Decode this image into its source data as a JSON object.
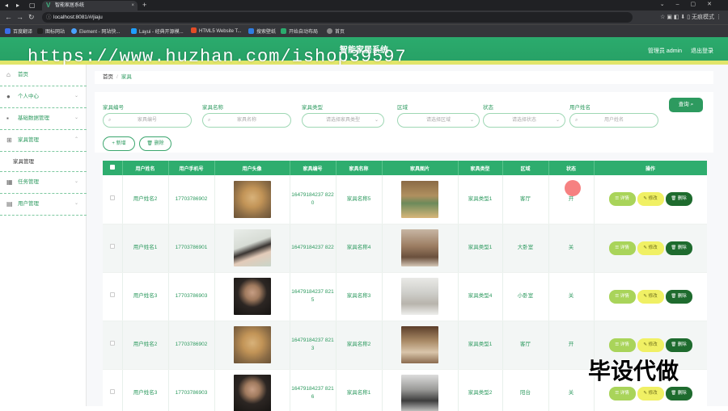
{
  "browser": {
    "tab_title": "智能家居系统",
    "url": "localhost:8081/#/jiaju",
    "profile_label": "无痕模式",
    "bookmarks": [
      "百度翻译",
      "图标网站",
      "Element - 网站快...",
      "Layui - 经典开源模...",
      "HTML5 Website T...",
      "搜索壁纸",
      "开始自动布局",
      "首页"
    ]
  },
  "header": {
    "title": "智能家居系统",
    "user": "管理员 admin",
    "logout": "退出登录"
  },
  "watermark_url": "https://www.huzhan.com/ishop39597",
  "watermark_corner": "毕设代做",
  "sidebar": {
    "items": [
      {
        "label": "首页",
        "icon": "home-icon"
      },
      {
        "label": "个人中心",
        "icon": "user-icon"
      },
      {
        "label": "基础数据管理",
        "icon": "briefcase-icon"
      },
      {
        "label": "家具管理",
        "icon": "grid-icon"
      },
      {
        "label": "家具管理",
        "icon": ""
      },
      {
        "label": "任务管理",
        "icon": "calendar-icon"
      },
      {
        "label": "用户管理",
        "icon": "doc-icon"
      }
    ]
  },
  "breadcrumb": {
    "home": "首页",
    "current": "家具"
  },
  "filters": [
    {
      "label": "家具编号",
      "placeholder": "家具编号"
    },
    {
      "label": "家具名称",
      "placeholder": "家具名称"
    },
    {
      "label": "家具类型",
      "placeholder": "请选择家具类型"
    },
    {
      "label": "区域",
      "placeholder": "请选择区域"
    },
    {
      "label": "状态",
      "placeholder": "请选择状态"
    },
    {
      "label": "用户姓名",
      "placeholder": "用户姓名"
    }
  ],
  "buttons": {
    "query": "查询",
    "add": "+ 新增",
    "delete": "删除"
  },
  "table": {
    "columns": [
      "用户姓名",
      "用户手机号",
      "用户头像",
      "家具编号",
      "家具名称",
      "家具图片",
      "家具类型",
      "区域",
      "状态",
      "操作"
    ],
    "rows": [
      {
        "name": "用户姓名2",
        "phone": "17703786902",
        "avatar": "p-dog",
        "code": "16479184237 8220",
        "fname": "家具名称5",
        "img": "r1",
        "type": "家具类型1",
        "area": "客厅",
        "status": "开"
      },
      {
        "name": "用户姓名1",
        "phone": "17703786901",
        "avatar": "p-girl",
        "code": "16479184237 822",
        "fname": "家具名称4",
        "img": "r2",
        "type": "家具类型1",
        "area": "大卧室",
        "status": "关"
      },
      {
        "name": "用户姓名3",
        "phone": "17703786903",
        "avatar": "p-man",
        "code": "16479184237 8215",
        "fname": "家具名称3",
        "img": "r3",
        "type": "家具类型4",
        "area": "小卧室",
        "status": "关"
      },
      {
        "name": "用户姓名2",
        "phone": "17703786902",
        "avatar": "p-dog",
        "code": "16479184237 8213",
        "fname": "家具名称2",
        "img": "r4",
        "type": "家具类型1",
        "area": "客厅",
        "status": "开"
      },
      {
        "name": "用户姓名3",
        "phone": "17703786903",
        "avatar": "p-man",
        "code": "16479184237 8216",
        "fname": "家具名称1",
        "img": "r5",
        "type": "家具类型2",
        "area": "阳台",
        "status": "关"
      }
    ],
    "op_labels": {
      "detail": "详情",
      "edit": "修改",
      "delete": "删除"
    }
  }
}
